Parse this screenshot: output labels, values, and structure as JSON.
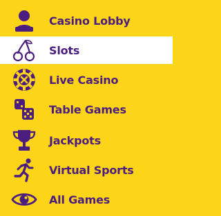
{
  "menu": {
    "colors": {
      "background": "#fcd418",
      "active_background": "#ffffff",
      "accent": "#4b1d7e"
    },
    "items": [
      {
        "label": "Casino Lobby",
        "icon": "person-icon",
        "active": false
      },
      {
        "label": "Slots",
        "icon": "cherries-icon",
        "active": true
      },
      {
        "label": "Live Casino",
        "icon": "casino-chip-icon",
        "active": false
      },
      {
        "label": "Table Games",
        "icon": "dice-icon",
        "active": false
      },
      {
        "label": "Jackpots",
        "icon": "trophy-icon",
        "active": false
      },
      {
        "label": "Virtual Sports",
        "icon": "runner-icon",
        "active": false
      },
      {
        "label": "All Games",
        "icon": "eye-icon",
        "active": false
      }
    ]
  }
}
